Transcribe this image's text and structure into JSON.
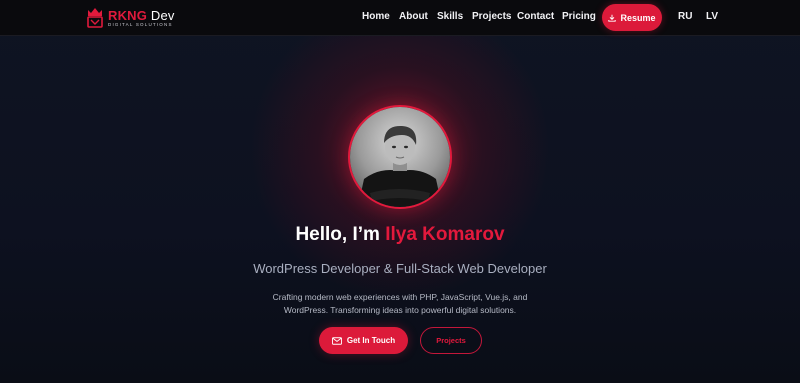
{
  "header": {
    "logo": {
      "brand": "RKNG",
      "name": "Dev",
      "tagline": "DIGITAL SOLUTIONS"
    },
    "nav": [
      {
        "label": "Home"
      },
      {
        "label": "About"
      },
      {
        "label": "Skills"
      },
      {
        "label": "Projects"
      },
      {
        "label": "Contact"
      },
      {
        "label": "Pricing"
      }
    ],
    "resume_label": "Resume",
    "languages": [
      "RU",
      "LV"
    ]
  },
  "hero": {
    "greeting": "Hello, I’m",
    "name": "Ilya Komarov",
    "subtitle": "WordPress Developer & Full-Stack Web Developer",
    "description": "Crafting modern web experiences with PHP, JavaScript, Vue.js, and WordPress. Transforming ideas into powerful digital solutions.",
    "primary_button": "Get In Touch",
    "secondary_button": "Projects"
  },
  "icons": {
    "resume": "download-icon",
    "contact": "envelope-icon",
    "logo": "crown-logo-icon"
  },
  "colors": {
    "accent": "#dc1a3a",
    "background": "#0d1120",
    "header": "#0a0a0d"
  }
}
